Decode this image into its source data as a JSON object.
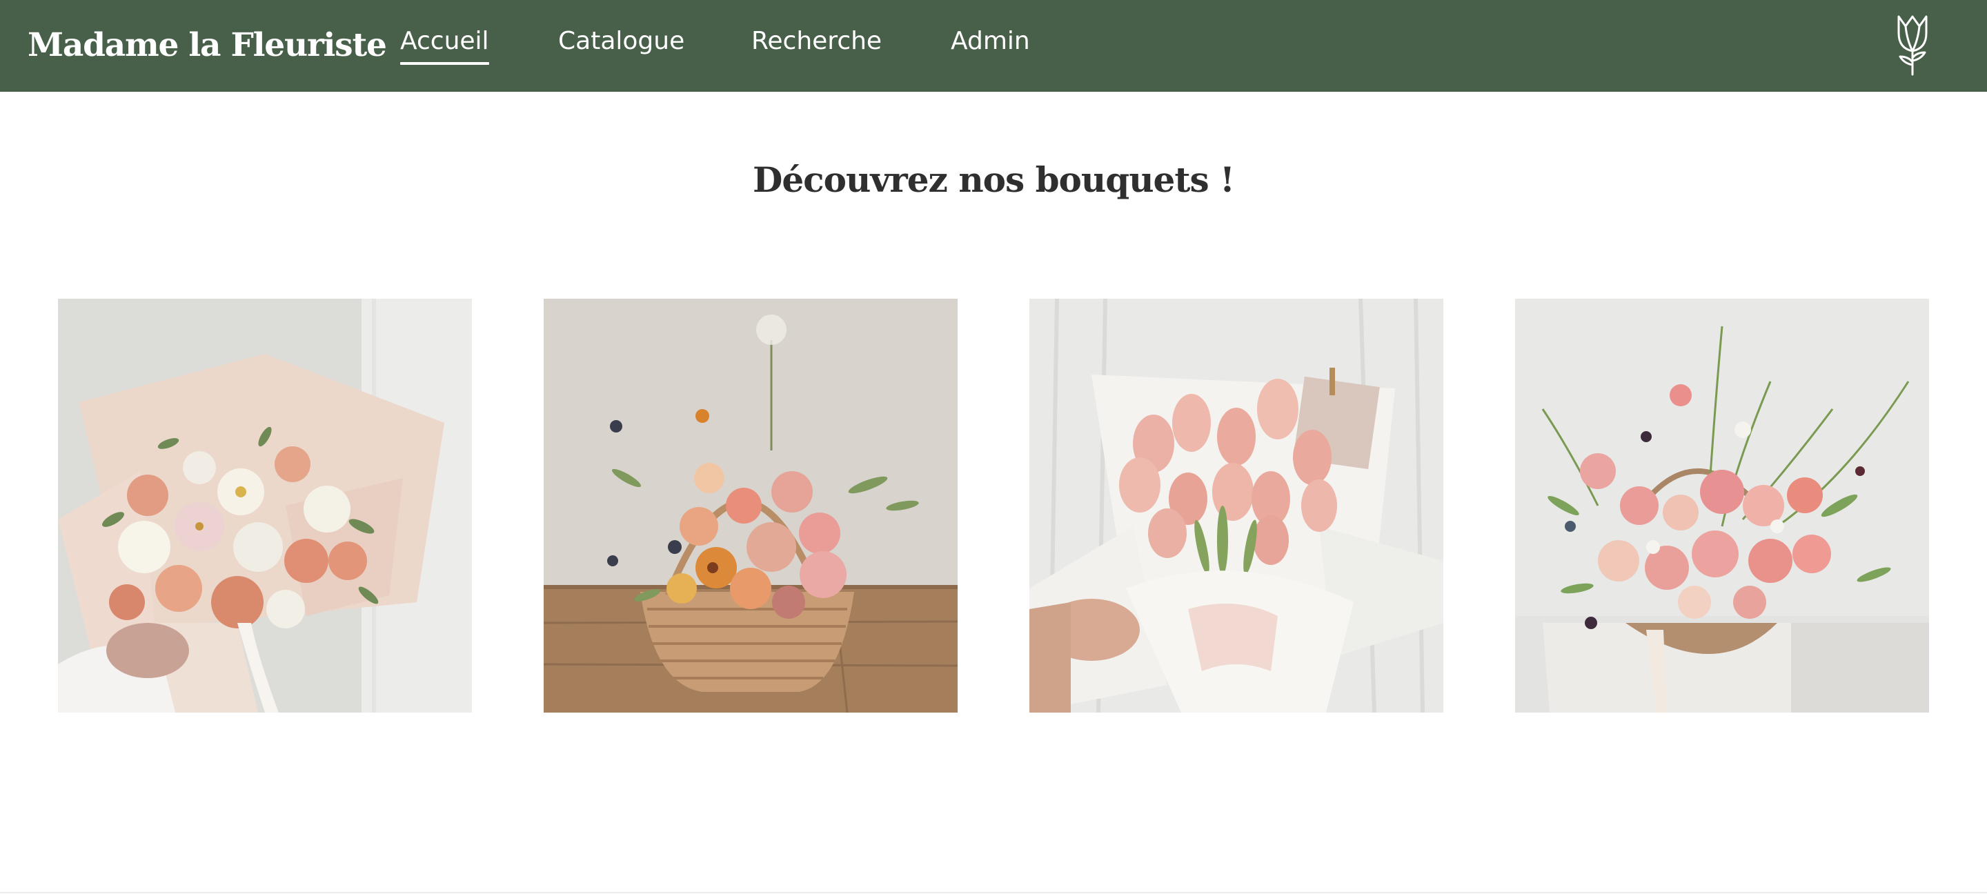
{
  "header": {
    "brand": "Madame la Fleuriste",
    "nav": [
      {
        "label": "Accueil",
        "active": true
      },
      {
        "label": "Catalogue",
        "active": false
      },
      {
        "label": "Recherche",
        "active": false
      },
      {
        "label": "Admin",
        "active": false
      }
    ],
    "logo_icon": "tulip-icon",
    "background_color": "#486049"
  },
  "main": {
    "title": "Découvrez nos bouquets !",
    "bouquets": [
      {
        "image": "bouquet-roses-peach-white-wrapped"
      },
      {
        "image": "basket-arrangement-roses-orange"
      },
      {
        "image": "bouquet-pink-tulips-white-wrap"
      },
      {
        "image": "basket-arrangement-pink-wildflowers"
      }
    ]
  }
}
